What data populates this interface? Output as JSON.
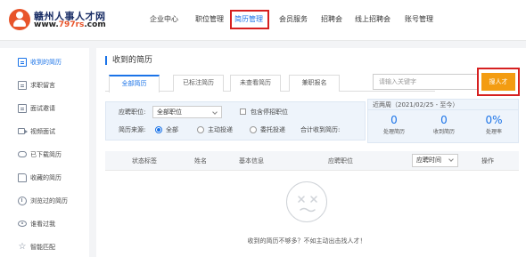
{
  "header": {
    "logo_name": "赣州人事人才网",
    "logo_url_prefix": "www.",
    "logo_url_highlight": "797rs",
    "logo_url_suffix": ".com",
    "nav": [
      {
        "label": "企业中心",
        "active": false
      },
      {
        "label": "职位管理",
        "active": false
      },
      {
        "label": "简历管理",
        "active": true
      },
      {
        "label": "会员服务",
        "active": false
      },
      {
        "label": "招聘会",
        "active": false
      },
      {
        "label": "线上招聘会",
        "active": false
      },
      {
        "label": "账号管理",
        "active": false
      }
    ]
  },
  "sidebar": {
    "items": [
      {
        "label": "收到的简历",
        "icon": "document-icon",
        "active": true
      },
      {
        "label": "求职留言",
        "icon": "message-icon",
        "active": false
      },
      {
        "label": "面试邀请",
        "icon": "invitation-icon",
        "active": false
      },
      {
        "label": "视频面试",
        "icon": "video-icon",
        "active": false
      },
      {
        "label": "已下载简历",
        "icon": "cloud-download-icon",
        "active": false
      },
      {
        "label": "收藏的简历",
        "icon": "folder-icon",
        "active": false
      },
      {
        "label": "浏览过的简历",
        "icon": "history-icon",
        "active": false
      },
      {
        "label": "谁看过我",
        "icon": "eye-icon",
        "active": false
      },
      {
        "label": "智能匹配",
        "icon": "star-icon",
        "active": false
      }
    ]
  },
  "main": {
    "title": "收到的简历",
    "tabs": [
      {
        "label": "全部简历",
        "active": true
      },
      {
        "label": "已标注简历",
        "active": false
      },
      {
        "label": "未查看简历",
        "active": false
      },
      {
        "label": "兼职报名",
        "active": false
      }
    ],
    "search": {
      "placeholder": "请输入关键字"
    },
    "post_button": "搜人才",
    "filters": {
      "position_label": "应聘职位:",
      "position_value": "全部职位",
      "include_closed_label": "包含停招职位",
      "source_label": "简历来源:",
      "source_options": [
        {
          "label": "全部",
          "checked": true
        },
        {
          "label": "主动投递",
          "checked": false
        },
        {
          "label": "委托投递",
          "checked": false
        }
      ],
      "total_label": "合计收到简历:"
    },
    "stats": {
      "period": "近两周（2021/02/25 - 至今）",
      "items": [
        {
          "value": "0",
          "label": "处理简历"
        },
        {
          "value": "0",
          "label": "收到简历"
        },
        {
          "value": "0%",
          "label": "处理率"
        }
      ]
    },
    "table": {
      "columns": [
        "状态标签",
        "姓名",
        "基本信息",
        "应聘职位",
        "操作"
      ],
      "sort_value": "应聘时间"
    },
    "empty_text": "收到的简历不够多？不如主动出击找人才！"
  }
}
